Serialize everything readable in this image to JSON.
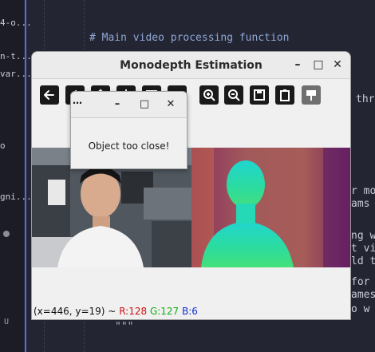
{
  "editor": {
    "sidebar_lines": [
      "4-o...",
      "n-t...",
      "var...",
      "o",
      "gni..."
    ],
    "sidebar_marker": "U",
    "code": {
      "comment_main": "# Main video processing function",
      "right_fragment_1": "thr",
      "right_fragment_2": "r mo",
      "right_fragment_3": "ams",
      "right_fragment_4": "ng w",
      "right_fragment_5": "t vi",
      "right_fragment_6": "ld t",
      "right_fragment_7": "for",
      "right_fragment_8": "ames",
      "right_fragment_9": "o w",
      "docstring_end": "\"\"\""
    }
  },
  "main_window": {
    "title": "Monodepth Estimation",
    "buttons": {
      "minimize": "–",
      "maximize": "□",
      "close": "✕"
    },
    "toolbar_icons": [
      "back-arrow-icon",
      "forward-arrow-icon",
      "home-icon",
      "pan-icon",
      "zoom-rect-icon",
      "settings-icon",
      "zoom-in-icon",
      "zoom-out-icon",
      "save-icon",
      "copy-clipboard-icon",
      "properties-icon"
    ],
    "status": {
      "coords": "(x=446, y=19) ~",
      "r": "R:128",
      "g": "G:127",
      "b": "B:6"
    }
  },
  "dialog": {
    "title": "…",
    "buttons": {
      "minimize": "–",
      "maximize": "□",
      "close": "✕"
    },
    "message": "Object too close!"
  }
}
